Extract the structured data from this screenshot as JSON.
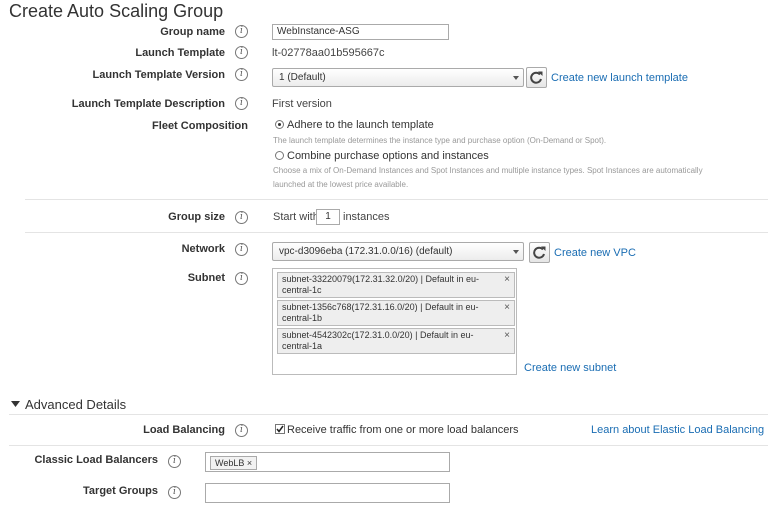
{
  "page": {
    "title": "Create Auto Scaling Group"
  },
  "form": {
    "group_name": {
      "label": "Group name",
      "value": "WebInstance-ASG"
    },
    "launch_template": {
      "label": "Launch Template",
      "value": "lt-02778aa01b595667c"
    },
    "launch_template_version": {
      "label": "Launch Template Version",
      "selected": "1 (Default)",
      "link": "Create new launch template"
    },
    "launch_template_description": {
      "label": "Launch Template Description",
      "value": "First version"
    },
    "fleet_composition": {
      "label": "Fleet Composition",
      "options": [
        {
          "label": "Adhere to the launch template",
          "selected": true,
          "hint": [
            "The launch template determines the instance type and purchase option (On-Demand or Spot)."
          ]
        },
        {
          "label": "Combine purchase options and instances",
          "selected": false,
          "hint": [
            "Choose a mix of On-Demand Instances and Spot Instances and multiple instance types. Spot Instances are automatically",
            "launched at the lowest price available."
          ]
        }
      ]
    },
    "group_size": {
      "label": "Group size",
      "prefix": "Start with",
      "value": "1",
      "suffix": "instances"
    },
    "network": {
      "label": "Network",
      "selected": "vpc-d3096eba (172.31.0.0/16) (default)",
      "link": "Create new VPC"
    },
    "subnet": {
      "label": "Subnet",
      "items": [
        {
          "line1": "subnet-33220079(172.31.32.0/20) | Default in eu-",
          "line2": "central-1c"
        },
        {
          "line1": "subnet-1356c768(172.31.16.0/20) | Default in eu-",
          "line2": "central-1b"
        },
        {
          "line1": "subnet-4542302c(172.31.0.0/20) | Default in eu-",
          "line2": "central-1a"
        }
      ],
      "link": "Create new subnet"
    }
  },
  "advanced": {
    "title": "Advanced Details",
    "load_balancing": {
      "label": "Load Balancing",
      "checkbox_label": "Receive traffic from one or more load balancers",
      "checked": true,
      "link": "Learn about Elastic Load Balancing"
    },
    "classic_load_balancers": {
      "label": "Classic Load Balancers",
      "tags": [
        "WebLB"
      ]
    },
    "target_groups": {
      "label": "Target Groups",
      "value": ""
    }
  },
  "icons": {
    "info": "i",
    "remove": "×",
    "caret_down": "caret-down-icon",
    "refresh": "refresh-icon",
    "check": "checkmark-icon",
    "section_toggle": "triangle-down-icon"
  }
}
